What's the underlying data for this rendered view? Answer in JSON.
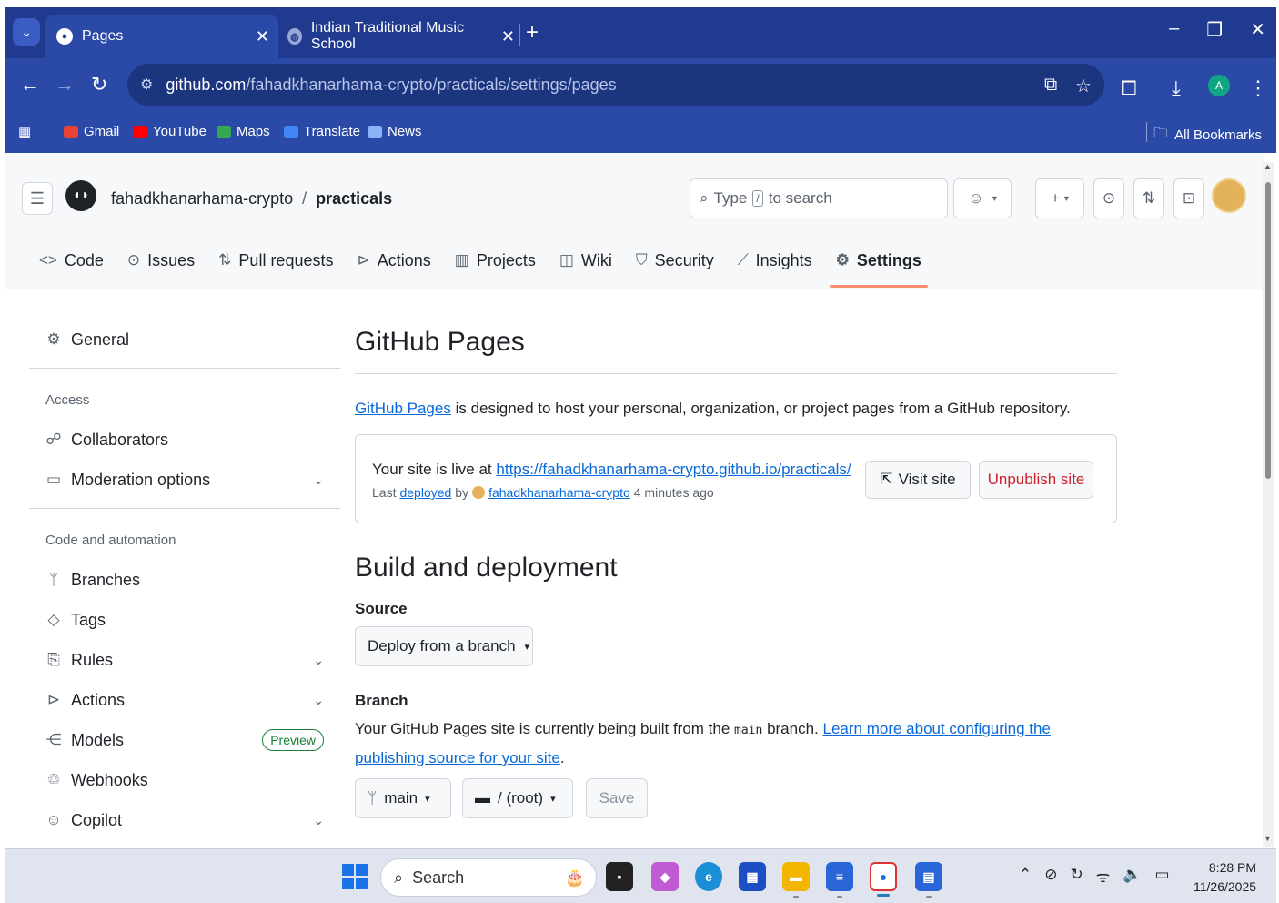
{
  "browser": {
    "tabs": [
      {
        "title": "Pages",
        "active": true
      },
      {
        "title": "Indian Traditional Music School",
        "active": false
      }
    ],
    "url_host": "github.com",
    "url_path": "/fahadkhanarhama-crypto/practicals/settings/pages",
    "profile_initial": "A",
    "bookmarks": [
      "Gmail",
      "YouTube",
      "Maps",
      "Translate",
      "News"
    ],
    "all_bookmarks": "All Bookmarks"
  },
  "github": {
    "owner": "fahadkhanarhama-crypto",
    "repo": "practicals",
    "search_prefix": "Type",
    "search_key": "/",
    "search_suffix": "to search",
    "tabs": [
      "Code",
      "Issues",
      "Pull requests",
      "Actions",
      "Projects",
      "Wiki",
      "Security",
      "Insights",
      "Settings"
    ],
    "active_tab": "Settings"
  },
  "sidebar": {
    "general": "General",
    "access_heading": "Access",
    "collaborators": "Collaborators",
    "moderation": "Moderation options",
    "code_heading": "Code and automation",
    "branches": "Branches",
    "tags": "Tags",
    "rules": "Rules",
    "actions": "Actions",
    "models": "Models",
    "preview_badge": "Preview",
    "webhooks": "Webhooks",
    "copilot": "Copilot"
  },
  "main": {
    "title": "GitHub Pages",
    "intro_link": "GitHub Pages",
    "intro_rest": " is designed to host your personal, organization, or project pages from a GitHub repository.",
    "live_prefix": "Your site is live at ",
    "live_url": "https://fahadkhanarhama-crypto.github.io/practicals/",
    "last": "Last",
    "deployed": "deployed",
    "by": "by",
    "deployer": "fahadkhanarhama-crypto",
    "time_ago": "4 minutes ago",
    "visit_button": "Visit site",
    "unpublish_button": "Unpublish site",
    "build_title": "Build and deployment",
    "source_label": "Source",
    "source_value": "Deploy from a branch",
    "branch_label": "Branch",
    "branch_desc_1": "Your GitHub Pages site is currently being built from the ",
    "branch_code": "main",
    "branch_desc_2": " branch. ",
    "branch_link": "Learn more about configuring the publishing source for your site",
    "branch_end": ".",
    "branch_value": "main",
    "folder_value": "/ (root)",
    "save_button": "Save"
  },
  "taskbar": {
    "search": "Search",
    "time": "8:28 PM",
    "date": "11/26/2025"
  }
}
